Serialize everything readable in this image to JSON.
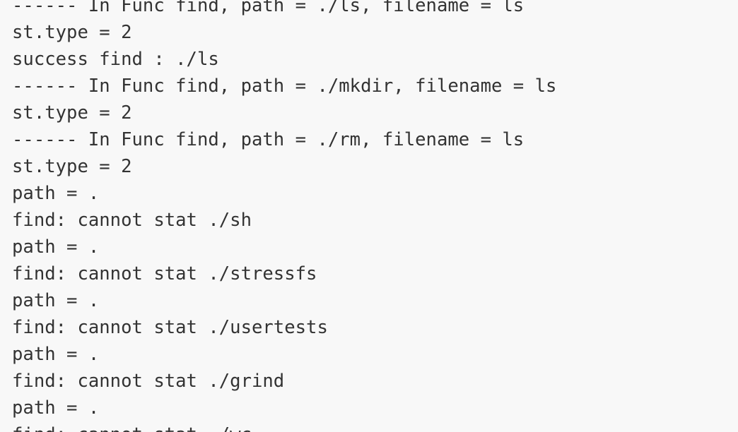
{
  "terminal": {
    "lines": [
      "------ In Func find, path = ./ls, filename = ls",
      "st.type = 2",
      "success find : ./ls",
      "------ In Func find, path = ./mkdir, filename = ls",
      "st.type = 2",
      "------ In Func find, path = ./rm, filename = ls",
      "st.type = 2",
      "path = .",
      "find: cannot stat ./sh",
      "path = .",
      "find: cannot stat ./stressfs",
      "path = .",
      "find: cannot stat ./usertests",
      "path = .",
      "find: cannot stat ./grind",
      "path = .",
      "find: cannot stat ./wc"
    ]
  }
}
